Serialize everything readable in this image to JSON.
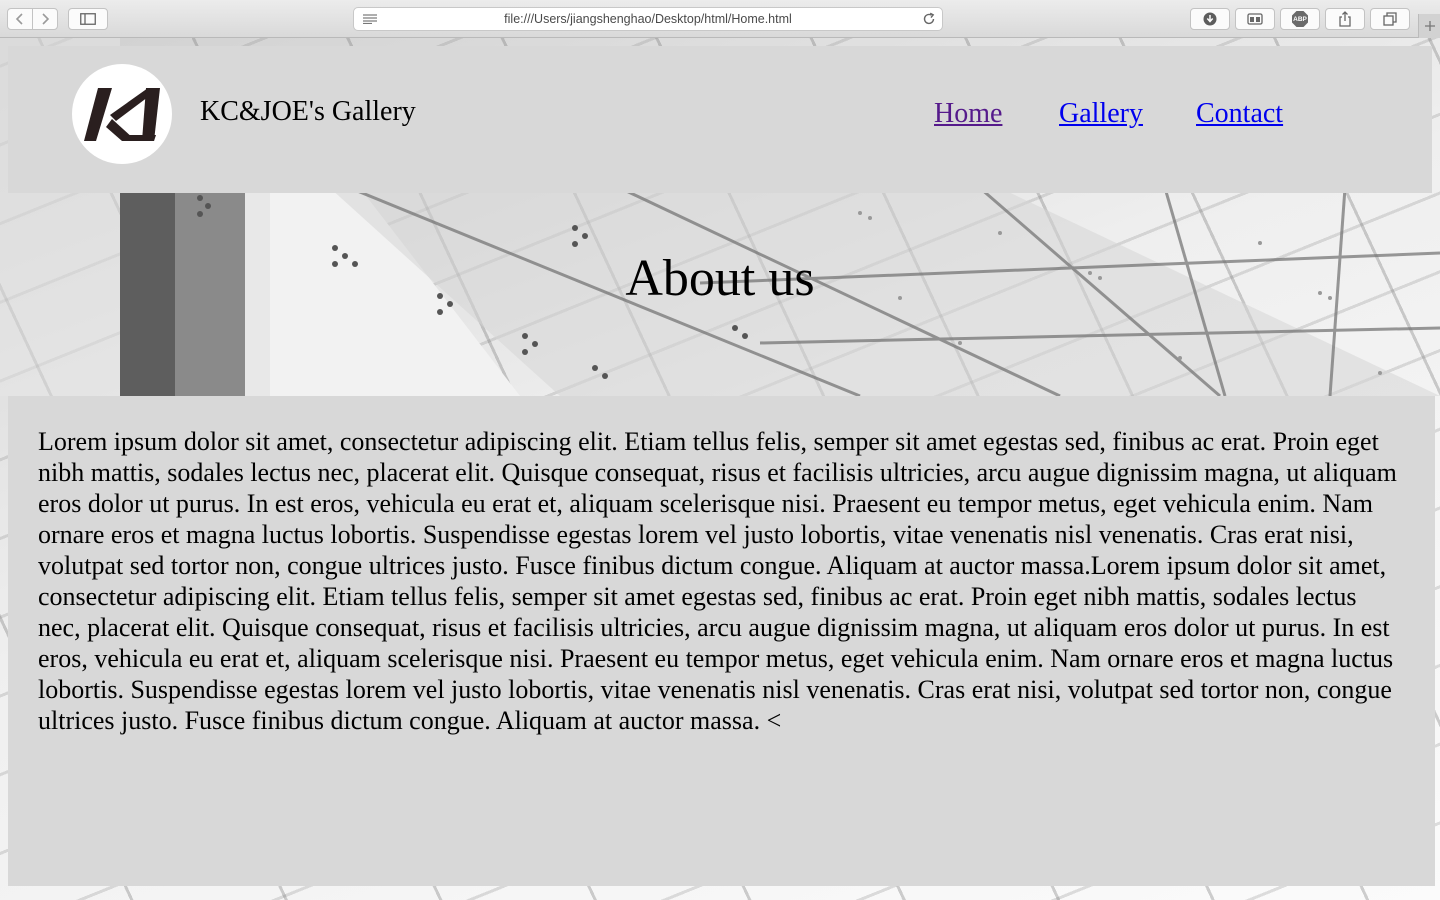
{
  "browser": {
    "url": "file:///Users/jiangshenghao/Desktop/html/Home.html",
    "toolbar_icons": [
      "back-icon",
      "forward-icon",
      "sidebar-icon",
      "reader-icon",
      "reload-icon",
      "download-icon",
      "tab-overview-icon",
      "adblock-icon",
      "share-icon",
      "tabs-icon",
      "new-tab-icon"
    ],
    "adblock_label": "ABP"
  },
  "site": {
    "title": "KC&JOE's Gallery",
    "logo_text": "KJ"
  },
  "nav": {
    "items": [
      {
        "label": "Home",
        "visited": true
      },
      {
        "label": "Gallery",
        "visited": false
      },
      {
        "label": "Contact",
        "visited": false
      }
    ]
  },
  "hero": {
    "heading": "About us"
  },
  "content": {
    "body": "Lorem ipsum dolor sit amet, consectetur adipiscing elit. Etiam tellus felis, semper sit amet egestas sed, finibus ac erat. Proin eget nibh mattis, sodales lectus nec, placerat elit. Quisque consequat, risus et facilisis ultricies, arcu augue dignissim magna, ut aliquam eros dolor ut purus. In est eros, vehicula eu erat et, aliquam scelerisque nisi. Praesent eu tempor metus, eget vehicula enim. Nam ornare eros et magna luctus lobortis. Suspendisse egestas lorem vel justo lobortis, vitae venenatis nisl venenatis. Cras erat nisi, volutpat sed tortor non, congue ultrices justo. Fusce finibus dictum congue. Aliquam at auctor massa.Lorem ipsum dolor sit amet, consectetur adipiscing elit. Etiam tellus felis, semper sit amet egestas sed, finibus ac erat. Proin eget nibh mattis, sodales lectus nec, placerat elit. Quisque consequat, risus et facilisis ultricies, arcu augue dignissim magna, ut aliquam eros dolor ut purus. In est eros, vehicula eu erat et, aliquam scelerisque nisi. Praesent eu tempor metus, eget vehicula enim. Nam ornare eros et magna luctus lobortis. Suspendisse egestas lorem vel justo lobortis, vitae venenatis nisl venenatis. Cras erat nisi, volutpat sed tortor non, congue ultrices justo. Fusce finibus dictum congue. Aliquam at auctor massa. <"
  },
  "colors": {
    "panel_bg": "#d8d8d8",
    "link": "#0000ee",
    "link_visited": "#551a8b"
  }
}
